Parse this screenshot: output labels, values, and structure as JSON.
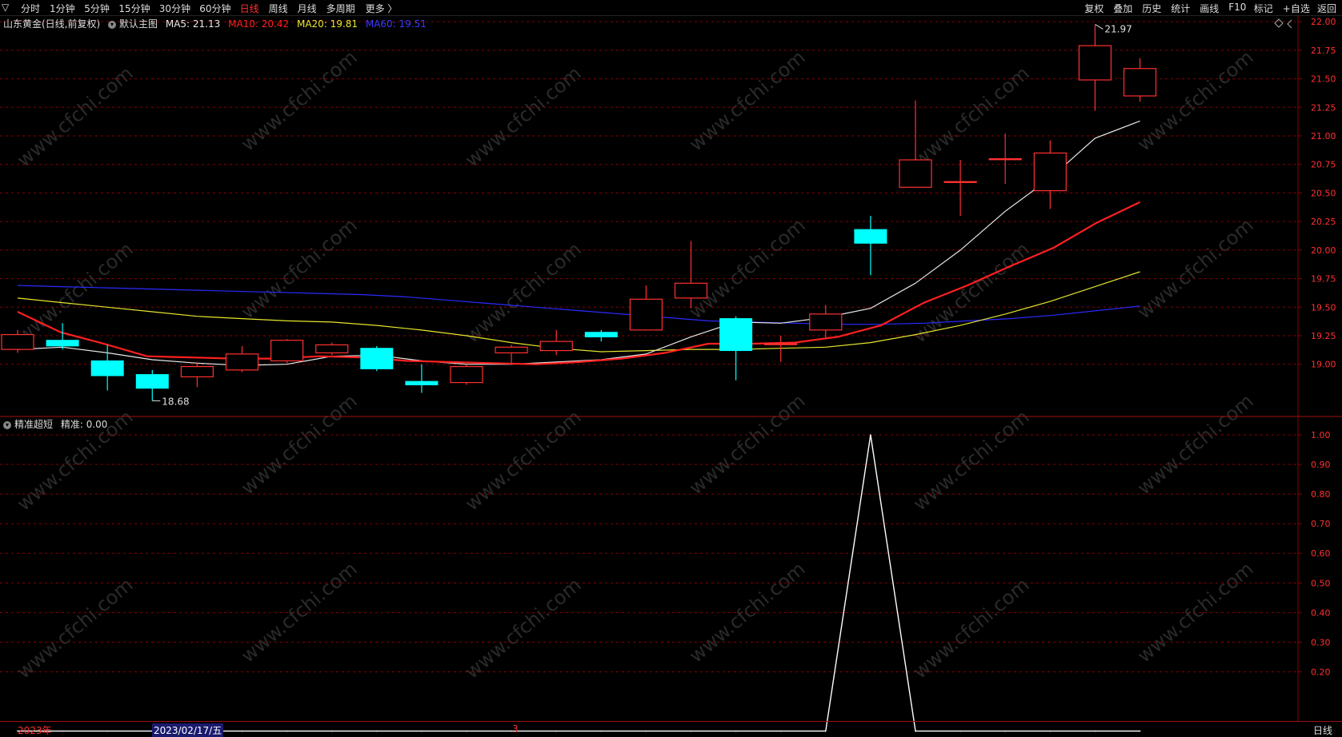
{
  "toolbar": {
    "corner": "▽",
    "periods": [
      "分时",
      "1分钟",
      "5分钟",
      "15分钟",
      "30分钟",
      "60分钟",
      "日线",
      "周线",
      "月线",
      "多周期",
      "更多 〉"
    ],
    "active_period": "日线",
    "actions": [
      "复权",
      "叠加",
      "历史",
      "统计",
      "画线",
      "F10",
      "标记",
      "+自选",
      "返回"
    ]
  },
  "main_legend": {
    "stock": "山东黄金(日线,前复权)",
    "template": "默认主图",
    "ma5": "MA5: 21.13",
    "ma10": "MA10: 20.42",
    "ma20": "MA20: 19.81",
    "ma60": "MA60: 19.51"
  },
  "indicator_legend": {
    "name": "精准超短",
    "value": "精准: 0.00"
  },
  "bottom_bar": {
    "year": "2023年",
    "cursor_date": "2023/02/17/五",
    "month_mark": "3",
    "period": "日线"
  },
  "watermark": "www.cfchi.com",
  "colors": {
    "up": "#ff3030",
    "down": "#00ffff",
    "ma5": "#e8e8e8",
    "ma10": "#ff2020",
    "ma20": "#e6e62e",
    "ma60": "#2a2aff",
    "grid": "#8b0000"
  },
  "chart_data": [
    {
      "type": "candlestick",
      "title": "山东黄金(日线,前复权)",
      "y_ticks": [
        "22.00",
        "21.75",
        "21.50",
        "21.25",
        "21.00",
        "20.75",
        "20.50",
        "20.25",
        "20.00",
        "19.75",
        "19.50",
        "19.25",
        "19.00"
      ],
      "ylim": [
        18.55,
        22.05
      ],
      "candles": [
        {
          "o": 19.13,
          "c": 19.26,
          "h": 19.3,
          "l": 19.1
        },
        {
          "o": 19.21,
          "c": 19.16,
          "h": 19.36,
          "l": 19.13
        },
        {
          "o": 19.03,
          "c": 18.9,
          "h": 19.17,
          "l": 18.77
        },
        {
          "o": 18.91,
          "c": 18.79,
          "h": 18.95,
          "l": 18.68
        },
        {
          "o": 18.89,
          "c": 18.98,
          "h": 19.02,
          "l": 18.8
        },
        {
          "o": 18.95,
          "c": 19.09,
          "h": 19.16,
          "l": 18.93
        },
        {
          "o": 19.03,
          "c": 19.21,
          "h": 19.22,
          "l": 19.01
        },
        {
          "o": 19.1,
          "c": 19.17,
          "h": 19.19,
          "l": 19.08
        },
        {
          "o": 19.14,
          "c": 18.96,
          "h": 19.16,
          "l": 18.94
        },
        {
          "o": 18.85,
          "c": 18.82,
          "h": 19.0,
          "l": 18.75
        },
        {
          "o": 18.84,
          "c": 18.98,
          "h": 19.0,
          "l": 18.82
        },
        {
          "o": 19.1,
          "c": 19.15,
          "h": 19.17,
          "l": 19.0
        },
        {
          "o": 19.12,
          "c": 19.2,
          "h": 19.3,
          "l": 19.08
        },
        {
          "o": 19.28,
          "c": 19.24,
          "h": 19.3,
          "l": 19.2
        },
        {
          "o": 19.3,
          "c": 19.57,
          "h": 19.69,
          "l": 19.3
        },
        {
          "o": 19.58,
          "c": 19.71,
          "h": 20.08,
          "l": 19.49
        },
        {
          "o": 19.4,
          "c": 19.12,
          "h": 19.42,
          "l": 18.86
        },
        {
          "o": 19.18,
          "c": 19.18,
          "h": 19.25,
          "l": 19.02
        },
        {
          "o": 19.3,
          "c": 19.44,
          "h": 19.52,
          "l": 19.22
        },
        {
          "o": 20.18,
          "c": 20.06,
          "h": 20.3,
          "l": 19.78
        },
        {
          "o": 20.55,
          "c": 20.79,
          "h": 21.31,
          "l": 20.55
        },
        {
          "o": 20.6,
          "c": 20.6,
          "h": 20.79,
          "l": 20.3
        },
        {
          "o": 20.8,
          "c": 20.8,
          "h": 21.02,
          "l": 20.58
        },
        {
          "o": 20.52,
          "c": 20.85,
          "h": 20.96,
          "l": 20.36
        },
        {
          "o": 21.49,
          "c": 21.79,
          "h": 21.97,
          "l": 21.22
        },
        {
          "o": 21.35,
          "c": 21.59,
          "h": 21.68,
          "l": 21.3
        }
      ],
      "high_label": "21.97",
      "low_label": "18.68",
      "ma": {
        "MA5": [
          19.13,
          19.15,
          19.1,
          19.04,
          19.01,
          18.99,
          19.0,
          19.07,
          19.08,
          19.03,
          19.0,
          19.0,
          19.02,
          19.04,
          19.09,
          19.24,
          19.37,
          19.36,
          19.41,
          19.49,
          19.71,
          20.0,
          20.34,
          20.63,
          20.98,
          21.13
        ],
        "MA10": [
          19.46,
          19.28,
          19.18,
          19.07,
          19.06,
          19.05,
          19.05,
          19.07,
          19.06,
          19.03,
          19.02,
          19.01,
          19.0,
          19.02,
          19.05,
          19.1,
          19.18,
          19.18,
          19.19,
          19.24,
          19.34,
          19.54,
          19.69,
          19.86,
          20.02,
          20.24,
          20.42
        ],
        "MA20": [
          19.58,
          19.54,
          19.5,
          19.46,
          19.42,
          19.4,
          19.38,
          19.37,
          19.34,
          19.3,
          19.25,
          19.19,
          19.14,
          19.11,
          19.12,
          19.13,
          19.13,
          19.14,
          19.15,
          19.19,
          19.26,
          19.34,
          19.44,
          19.55,
          19.68,
          19.81
        ],
        "MA60": [
          19.69,
          19.68,
          19.67,
          19.66,
          19.65,
          19.64,
          19.63,
          19.62,
          19.61,
          19.59,
          19.56,
          19.53,
          19.5,
          19.47,
          19.44,
          19.41,
          19.38,
          19.37,
          19.36,
          19.35,
          19.35,
          19.36,
          19.38,
          19.4,
          19.43,
          19.47,
          19.51
        ]
      }
    },
    {
      "type": "line",
      "title": "精准超短",
      "y_ticks": [
        "1.00",
        "0.90",
        "0.80",
        "0.70",
        "0.60",
        "0.50",
        "0.40",
        "0.30",
        "0.20"
      ],
      "ylim": [
        -0.02,
        1.0
      ],
      "series": [
        {
          "name": "精准",
          "values": [
            0,
            0,
            0,
            0,
            0,
            0,
            0,
            0,
            0,
            0,
            0,
            0,
            0,
            0,
            0,
            0,
            0,
            0,
            0,
            1,
            0,
            0,
            0,
            0,
            0,
            0
          ]
        }
      ]
    }
  ]
}
